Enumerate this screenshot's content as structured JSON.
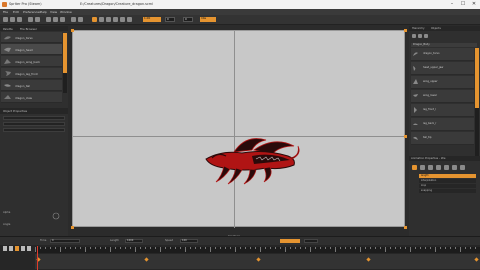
{
  "window": {
    "app_title": "Spriter Pro (Steam)",
    "document_title": "E:/Creatures/Dragon/Creature_dragon.scml",
    "minimize": "–",
    "maximize": "☐",
    "close": "✕"
  },
  "menu": [
    "File",
    "Edit",
    "Preferences",
    "Help",
    "View",
    "Window"
  ],
  "toolbar": {
    "zoom_value": "1.00",
    "field_2": "0",
    "field_3": "0",
    "anim_name": "Idle"
  },
  "left_panel": {
    "tabs": [
      "Palette",
      "File Browser"
    ],
    "library_items": [
      {
        "label": "dragon_torso"
      },
      {
        "label": "dragon_head"
      },
      {
        "label": "dragon_wing_back"
      },
      {
        "label": "dragon_leg_front"
      },
      {
        "label": "dragon_tail"
      },
      {
        "label": "dragon_claw"
      }
    ],
    "props_title": "Object Properties",
    "labels": [
      "Alpha",
      "Angle"
    ]
  },
  "stage": {
    "label": "Creature"
  },
  "right_panel": {
    "tabs": [
      "Hierarchy",
      "Objects"
    ],
    "header": "Dragon_Body",
    "tree_items": [
      {
        "label": "dragon_torso"
      },
      {
        "label": "head_upper_jaw"
      },
      {
        "label": "wing_upper"
      },
      {
        "label": "wing_lower"
      },
      {
        "label": "leg_front_l"
      },
      {
        "label": "leg_back_r"
      },
      {
        "label": "tail_tip"
      }
    ],
    "section_title": "Animation Properties - Idle",
    "prop_rows": [
      "length",
      "interpolation",
      "loop",
      "snapping"
    ]
  },
  "timeline": {
    "labels": [
      "Time",
      "Length",
      "Speed"
    ],
    "time_value": "0",
    "length_value": "1000",
    "speed_value": "100"
  },
  "colors": {
    "accent": "#e59430",
    "creature_dark": "#2a0a0a",
    "creature_red": "#b01414"
  }
}
